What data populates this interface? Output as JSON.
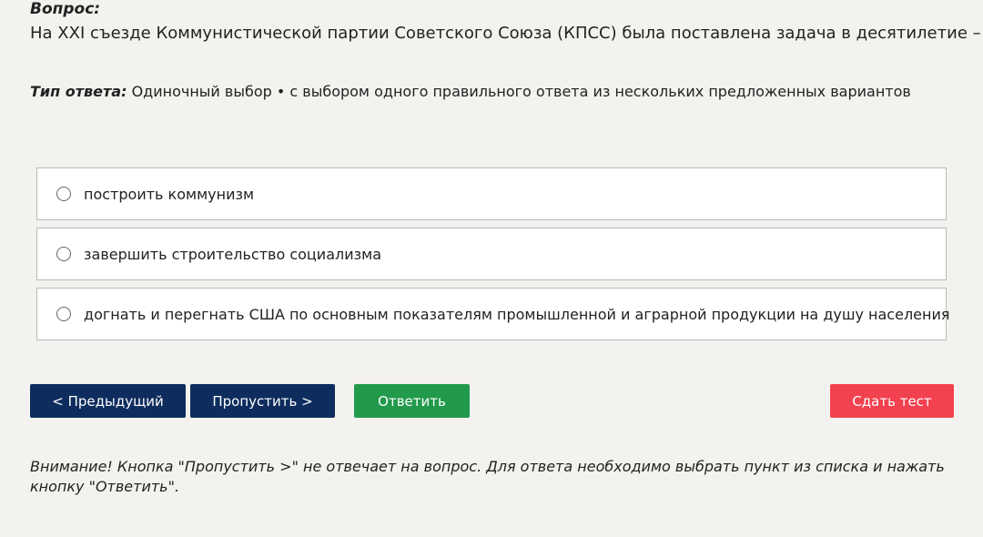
{
  "question": {
    "label": "Вопрос:",
    "text": "На XXI съезде Коммунистической партии Советского Союза (КПСС) была поставлена задача в десятилетие – ..."
  },
  "answer_type": {
    "label": "Тип ответа:",
    "value": "Одиночный выбор • с выбором одного правильного ответа из нескольких предложенных вариантов"
  },
  "options": [
    {
      "label": "построить коммунизм",
      "selected": false
    },
    {
      "label": "завершить строительство социализма",
      "selected": false
    },
    {
      "label": "догнать и перегнать США по основным показателям промышленной и аграрной продукции на душу населения",
      "selected": false
    }
  ],
  "buttons": {
    "prev": "< Предыдущий",
    "skip": "Пропустить >",
    "answer": "Ответить",
    "finish": "Сдать тест"
  },
  "notice": "Внимание! Кнопка \"Пропустить >\" не отвечает на вопрос. Для ответа необходимо выбрать пункт из списка и нажать кнопку \"Ответить\".",
  "colors": {
    "background": "#f3f2ef",
    "primary_button": "#0e2d5e",
    "answer_button": "#229a4c",
    "finish_button": "#f2414f"
  }
}
